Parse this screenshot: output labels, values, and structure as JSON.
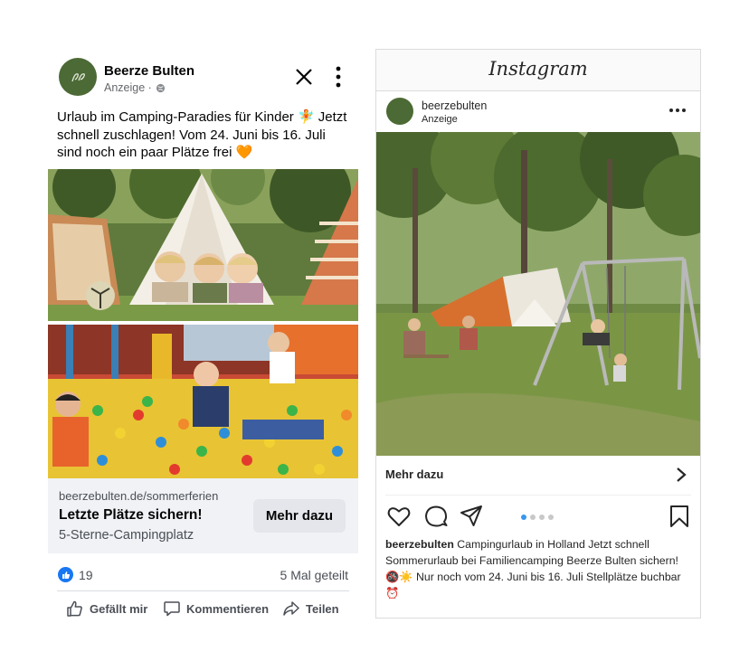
{
  "facebook": {
    "page_name": "Beerze Bulten",
    "sponsored": "Anzeige ·",
    "post_text": "Urlaub im Camping-Paradies für Kinder 🧚 Jetzt schnell zuschlagen! Vom 24. Juni bis 16. Juli sind noch ein paar Plätze frei 🧡",
    "link": {
      "url": "beerzebulten.de/sommerferien",
      "headline": "Letzte Plätze sichern!",
      "description": "5-Sterne-Campingplatz",
      "cta": "Mehr dazu"
    },
    "likes": "19",
    "shares": "5 Mal geteilt",
    "actions": {
      "like": "Gefällt mir",
      "comment": "Kommentieren",
      "share": "Teilen"
    },
    "colors": {
      "brand_green": "#4b6a35",
      "like_blue": "#1877f2"
    }
  },
  "instagram": {
    "app_title": "Instagram",
    "username": "beerzebulten",
    "sponsored": "Anzeige",
    "cta": "Mehr dazu",
    "caption_user": "beerzebulten",
    "caption_text": "Campingurlaub in Holland Jetzt schnell Sommerurlaub bei Familiencamping Beerze Bulten sichern! 🚳☀️ Nur noch vom 24. Juni bis 16. Juli Stellplätze buchbar ⏰",
    "carousel": {
      "total": 4,
      "active": 1
    }
  }
}
